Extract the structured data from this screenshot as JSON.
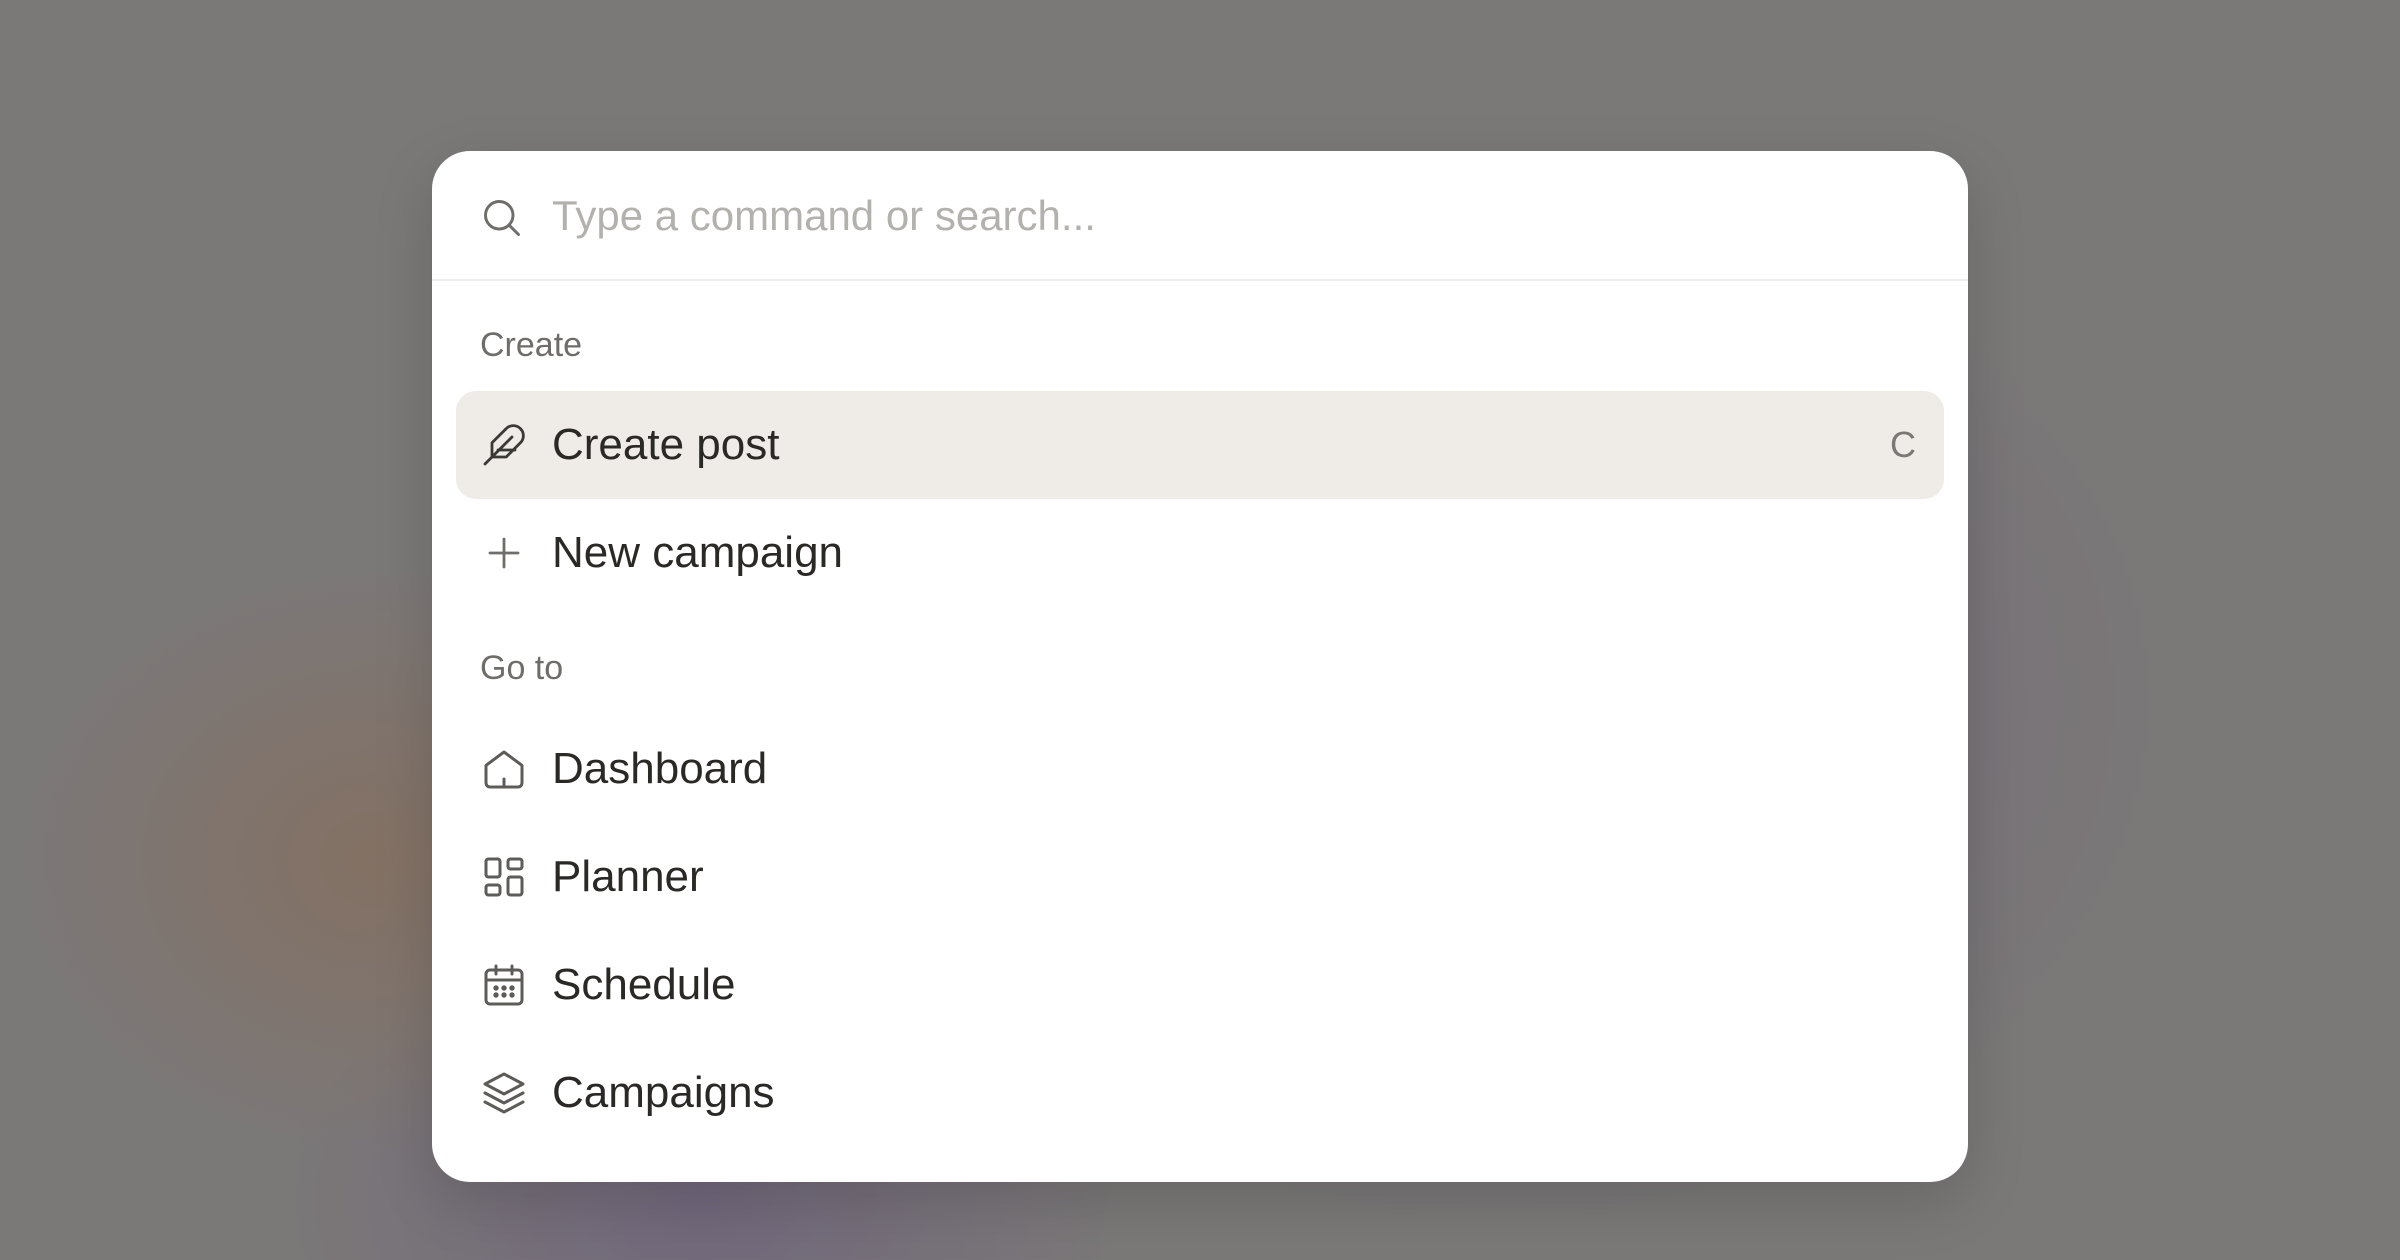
{
  "search": {
    "placeholder": "Type a command or search...",
    "value": ""
  },
  "sections": [
    {
      "label": "Create",
      "items": [
        {
          "label": "Create post",
          "icon": "feather-icon",
          "shortcut": "C",
          "active": true
        },
        {
          "label": "New campaign",
          "icon": "plus-icon",
          "shortcut": "",
          "active": false
        }
      ]
    },
    {
      "label": "Go to",
      "items": [
        {
          "label": "Dashboard",
          "icon": "home-icon"
        },
        {
          "label": "Planner",
          "icon": "layout-grid-icon"
        },
        {
          "label": "Schedule",
          "icon": "calendar-icon"
        },
        {
          "label": "Campaigns",
          "icon": "layers-icon"
        }
      ]
    }
  ],
  "colors": {
    "active_item_bg": "#efebe6",
    "text": "#2a2926",
    "muted": "#6f6d6a",
    "placeholder": "#b3b1ae"
  }
}
